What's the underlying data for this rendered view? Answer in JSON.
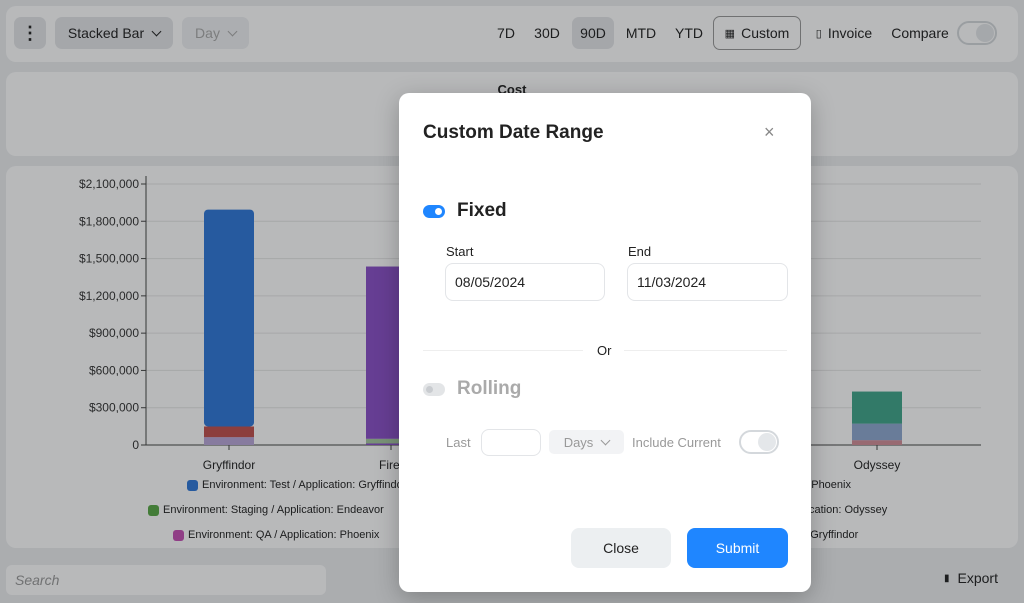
{
  "toolbar": {
    "chart_type": "Stacked Bar",
    "granularity": "Day",
    "ranges": [
      "7D",
      "30D",
      "90D",
      "MTD",
      "YTD"
    ],
    "selected_range": "90D",
    "custom_label": "Custom",
    "invoice_label": "Invoice",
    "compare_label": "Compare",
    "compare_on": false
  },
  "cost_panel": {
    "title": "Cost"
  },
  "chart_data": {
    "type": "bar",
    "stacked": true,
    "categories": [
      "Gryffindor",
      "Firef",
      "",
      "",
      "Odyssey"
    ],
    "ylim": [
      0,
      2100000
    ],
    "yticks": [
      0,
      300000,
      600000,
      900000,
      1200000,
      1500000,
      1800000,
      2100000
    ],
    "ytick_labels": [
      "0",
      "$300,000",
      "$600,000",
      "$900,000",
      "$1,200,000",
      "$1,500,000",
      "$1,800,000",
      "$2,100,000"
    ],
    "grid": true,
    "series": [
      {
        "name": "Environment: Test / Application: Gryffindo",
        "color": "#2f78d8",
        "values": [
          1745000,
          0,
          0,
          0,
          0
        ]
      },
      {
        "color": "#c0504d",
        "values": [
          86000,
          0,
          0,
          0,
          0
        ]
      },
      {
        "color": "#b9a6d8",
        "values": [
          63000,
          0,
          0,
          0,
          0
        ]
      },
      {
        "color": "#8a50c8",
        "values": [
          0,
          1386000,
          0,
          0,
          0
        ]
      },
      {
        "name": "Environment: Staging / Application: Endeavor",
        "color": "#a5c8a0",
        "values": [
          0,
          50000,
          0,
          0,
          0
        ]
      },
      {
        "color": "#d28e98",
        "values": [
          0,
          0,
          0,
          0,
          39000
        ]
      },
      {
        "color": "#8fa8d0",
        "values": [
          0,
          0,
          0,
          0,
          133000
        ]
      },
      {
        "color": "#3fa58a",
        "values": [
          0,
          0,
          0,
          0,
          258000
        ]
      }
    ]
  },
  "legend": {
    "items": [
      {
        "label": "Environment: Test / Application: Gryffindo",
        "color": "#2f78d8"
      },
      {
        "label": "n: Phoenix",
        "color": ""
      },
      {
        "label": "Environment: Staging / Application: Endeavor",
        "color": "#58a846"
      },
      {
        "label": "plication: Odyssey",
        "color": ""
      },
      {
        "label": "Environment: QA / Application: Phoenix",
        "color": "#c64fb5"
      },
      {
        "label": "n: Gryffindor",
        "color": ""
      }
    ]
  },
  "search": {
    "placeholder": "Search"
  },
  "export_label": "Export",
  "modal": {
    "title": "Custom Date Range",
    "fixed_label": "Fixed",
    "fixed_on": true,
    "start_label": "Start",
    "start_value": "08/05/2024",
    "end_label": "End",
    "end_value": "11/03/2024",
    "or_label": "Or",
    "rolling_label": "Rolling",
    "rolling_on": false,
    "last_label": "Last",
    "last_value": "",
    "unit": "Days",
    "include_current_label": "Include Current",
    "include_current_on": false,
    "close_label": "Close",
    "submit_label": "Submit"
  },
  "colors": {
    "accent": "#1f86ff"
  }
}
